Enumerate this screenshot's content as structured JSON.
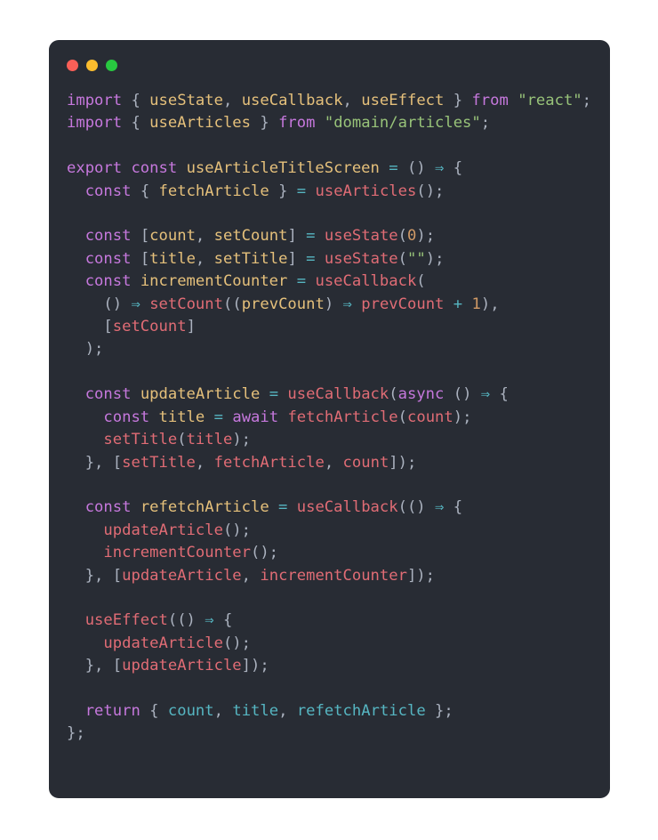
{
  "window": {
    "chrome_dots": [
      {
        "name": "close-dot",
        "color": "#fa5f57"
      },
      {
        "name": "minimize-dot",
        "color": "#fbbd2e"
      },
      {
        "name": "maximize-dot",
        "color": "#28c840"
      }
    ]
  },
  "theme": {
    "page_background": "#ffffff",
    "card_background": "#282c34",
    "default_text": "#abb2bf",
    "keyword": "#c678dd",
    "entity": "#e5c07b",
    "string": "#98c379",
    "function": "#e06c75",
    "variable": "#e06c75",
    "property": "#56b6c2",
    "operator": "#56b6c2",
    "number": "#d19a66",
    "punctuation": "#abb2bf"
  },
  "code": {
    "language": "javascript",
    "plain_text": "import { useState, useCallback, useEffect } from \"react\";\nimport { useArticles } from \"domain/articles\";\n\nexport const useArticleTitleScreen = () ⇒ {\n  const { fetchArticle } = useArticles();\n\n  const [count, setCount] = useState(0);\n  const [title, setTitle] = useState(\"\");\n  const incrementCounter = useCallback(\n    () ⇒ setCount((prevCount) ⇒ prevCount + 1),\n    [setCount]\n  );\n\n  const updateArticle = useCallback(async () ⇒ {\n    const title = await fetchArticle(count);\n    setTitle(title);\n  }, [setTitle, fetchArticle, count]);\n\n  const refetchArticle = useCallback(() ⇒ {\n    updateArticle();\n    incrementCounter();\n  }, [updateArticle, incrementCounter]);\n\n  useEffect(() ⇒ {\n    updateArticle();\n  }, [updateArticle]);\n\n  return { count, title, refetchArticle };\n};",
    "lines": [
      [
        {
          "k": "keyword",
          "t": "import"
        },
        {
          "k": "plain",
          "t": " "
        },
        {
          "k": "punct",
          "t": "{"
        },
        {
          "k": "plain",
          "t": " "
        },
        {
          "k": "entity",
          "t": "useState"
        },
        {
          "k": "punct",
          "t": ","
        },
        {
          "k": "plain",
          "t": " "
        },
        {
          "k": "entity",
          "t": "useCallback"
        },
        {
          "k": "punct",
          "t": ","
        },
        {
          "k": "plain",
          "t": " "
        },
        {
          "k": "entity",
          "t": "useEffect"
        },
        {
          "k": "plain",
          "t": " "
        },
        {
          "k": "punct",
          "t": "}"
        },
        {
          "k": "plain",
          "t": " "
        },
        {
          "k": "keyword",
          "t": "from"
        },
        {
          "k": "plain",
          "t": " "
        },
        {
          "k": "string",
          "t": "\"react\""
        },
        {
          "k": "punct",
          "t": ";"
        }
      ],
      [
        {
          "k": "keyword",
          "t": "import"
        },
        {
          "k": "plain",
          "t": " "
        },
        {
          "k": "punct",
          "t": "{"
        },
        {
          "k": "plain",
          "t": " "
        },
        {
          "k": "entity",
          "t": "useArticles"
        },
        {
          "k": "plain",
          "t": " "
        },
        {
          "k": "punct",
          "t": "}"
        },
        {
          "k": "plain",
          "t": " "
        },
        {
          "k": "keyword",
          "t": "from"
        },
        {
          "k": "plain",
          "t": " "
        },
        {
          "k": "string",
          "t": "\"domain/articles\""
        },
        {
          "k": "punct",
          "t": ";"
        }
      ],
      [],
      [
        {
          "k": "keyword",
          "t": "export"
        },
        {
          "k": "plain",
          "t": " "
        },
        {
          "k": "keyword",
          "t": "const"
        },
        {
          "k": "plain",
          "t": " "
        },
        {
          "k": "entity",
          "t": "useArticleTitleScreen"
        },
        {
          "k": "plain",
          "t": " "
        },
        {
          "k": "operator",
          "t": "="
        },
        {
          "k": "plain",
          "t": " "
        },
        {
          "k": "punct",
          "t": "()"
        },
        {
          "k": "plain",
          "t": " "
        },
        {
          "k": "operator",
          "t": "⇒"
        },
        {
          "k": "plain",
          "t": " "
        },
        {
          "k": "punct",
          "t": "{"
        }
      ],
      [
        {
          "k": "plain",
          "t": "  "
        },
        {
          "k": "keyword",
          "t": "const"
        },
        {
          "k": "plain",
          "t": " "
        },
        {
          "k": "punct",
          "t": "{"
        },
        {
          "k": "plain",
          "t": " "
        },
        {
          "k": "entity",
          "t": "fetchArticle"
        },
        {
          "k": "plain",
          "t": " "
        },
        {
          "k": "punct",
          "t": "}"
        },
        {
          "k": "plain",
          "t": " "
        },
        {
          "k": "operator",
          "t": "="
        },
        {
          "k": "plain",
          "t": " "
        },
        {
          "k": "func",
          "t": "useArticles"
        },
        {
          "k": "punct",
          "t": "();"
        }
      ],
      [],
      [
        {
          "k": "plain",
          "t": "  "
        },
        {
          "k": "keyword",
          "t": "const"
        },
        {
          "k": "plain",
          "t": " "
        },
        {
          "k": "punct",
          "t": "["
        },
        {
          "k": "entity",
          "t": "count"
        },
        {
          "k": "punct",
          "t": ","
        },
        {
          "k": "plain",
          "t": " "
        },
        {
          "k": "entity",
          "t": "setCount"
        },
        {
          "k": "punct",
          "t": "]"
        },
        {
          "k": "plain",
          "t": " "
        },
        {
          "k": "operator",
          "t": "="
        },
        {
          "k": "plain",
          "t": " "
        },
        {
          "k": "func",
          "t": "useState"
        },
        {
          "k": "punct",
          "t": "("
        },
        {
          "k": "number",
          "t": "0"
        },
        {
          "k": "punct",
          "t": ");"
        }
      ],
      [
        {
          "k": "plain",
          "t": "  "
        },
        {
          "k": "keyword",
          "t": "const"
        },
        {
          "k": "plain",
          "t": " "
        },
        {
          "k": "punct",
          "t": "["
        },
        {
          "k": "entity",
          "t": "title"
        },
        {
          "k": "punct",
          "t": ","
        },
        {
          "k": "plain",
          "t": " "
        },
        {
          "k": "entity",
          "t": "setTitle"
        },
        {
          "k": "punct",
          "t": "]"
        },
        {
          "k": "plain",
          "t": " "
        },
        {
          "k": "operator",
          "t": "="
        },
        {
          "k": "plain",
          "t": " "
        },
        {
          "k": "func",
          "t": "useState"
        },
        {
          "k": "punct",
          "t": "("
        },
        {
          "k": "string",
          "t": "\"\""
        },
        {
          "k": "punct",
          "t": ");"
        }
      ],
      [
        {
          "k": "plain",
          "t": "  "
        },
        {
          "k": "keyword",
          "t": "const"
        },
        {
          "k": "plain",
          "t": " "
        },
        {
          "k": "entity",
          "t": "incrementCounter"
        },
        {
          "k": "plain",
          "t": " "
        },
        {
          "k": "operator",
          "t": "="
        },
        {
          "k": "plain",
          "t": " "
        },
        {
          "k": "func",
          "t": "useCallback"
        },
        {
          "k": "punct",
          "t": "("
        }
      ],
      [
        {
          "k": "plain",
          "t": "    "
        },
        {
          "k": "punct",
          "t": "()"
        },
        {
          "k": "plain",
          "t": " "
        },
        {
          "k": "operator",
          "t": "⇒"
        },
        {
          "k": "plain",
          "t": " "
        },
        {
          "k": "func",
          "t": "setCount"
        },
        {
          "k": "punct",
          "t": "(("
        },
        {
          "k": "entity",
          "t": "prevCount"
        },
        {
          "k": "punct",
          "t": ")"
        },
        {
          "k": "plain",
          "t": " "
        },
        {
          "k": "operator",
          "t": "⇒"
        },
        {
          "k": "plain",
          "t": " "
        },
        {
          "k": "var",
          "t": "prevCount"
        },
        {
          "k": "plain",
          "t": " "
        },
        {
          "k": "operator",
          "t": "+"
        },
        {
          "k": "plain",
          "t": " "
        },
        {
          "k": "number",
          "t": "1"
        },
        {
          "k": "punct",
          "t": "),"
        }
      ],
      [
        {
          "k": "plain",
          "t": "    "
        },
        {
          "k": "punct",
          "t": "["
        },
        {
          "k": "var",
          "t": "setCount"
        },
        {
          "k": "punct",
          "t": "]"
        }
      ],
      [
        {
          "k": "plain",
          "t": "  "
        },
        {
          "k": "punct",
          "t": ");"
        }
      ],
      [],
      [
        {
          "k": "plain",
          "t": "  "
        },
        {
          "k": "keyword",
          "t": "const"
        },
        {
          "k": "plain",
          "t": " "
        },
        {
          "k": "entity",
          "t": "updateArticle"
        },
        {
          "k": "plain",
          "t": " "
        },
        {
          "k": "operator",
          "t": "="
        },
        {
          "k": "plain",
          "t": " "
        },
        {
          "k": "func",
          "t": "useCallback"
        },
        {
          "k": "punct",
          "t": "("
        },
        {
          "k": "keyword",
          "t": "async"
        },
        {
          "k": "plain",
          "t": " "
        },
        {
          "k": "punct",
          "t": "()"
        },
        {
          "k": "plain",
          "t": " "
        },
        {
          "k": "operator",
          "t": "⇒"
        },
        {
          "k": "plain",
          "t": " "
        },
        {
          "k": "punct",
          "t": "{"
        }
      ],
      [
        {
          "k": "plain",
          "t": "    "
        },
        {
          "k": "keyword",
          "t": "const"
        },
        {
          "k": "plain",
          "t": " "
        },
        {
          "k": "entity",
          "t": "title"
        },
        {
          "k": "plain",
          "t": " "
        },
        {
          "k": "operator",
          "t": "="
        },
        {
          "k": "plain",
          "t": " "
        },
        {
          "k": "keyword",
          "t": "await"
        },
        {
          "k": "plain",
          "t": " "
        },
        {
          "k": "func",
          "t": "fetchArticle"
        },
        {
          "k": "punct",
          "t": "("
        },
        {
          "k": "var",
          "t": "count"
        },
        {
          "k": "punct",
          "t": ");"
        }
      ],
      [
        {
          "k": "plain",
          "t": "    "
        },
        {
          "k": "func",
          "t": "setTitle"
        },
        {
          "k": "punct",
          "t": "("
        },
        {
          "k": "var",
          "t": "title"
        },
        {
          "k": "punct",
          "t": ");"
        }
      ],
      [
        {
          "k": "plain",
          "t": "  "
        },
        {
          "k": "punct",
          "t": "},"
        },
        {
          "k": "plain",
          "t": " "
        },
        {
          "k": "punct",
          "t": "["
        },
        {
          "k": "var",
          "t": "setTitle"
        },
        {
          "k": "punct",
          "t": ","
        },
        {
          "k": "plain",
          "t": " "
        },
        {
          "k": "var",
          "t": "fetchArticle"
        },
        {
          "k": "punct",
          "t": ","
        },
        {
          "k": "plain",
          "t": " "
        },
        {
          "k": "var",
          "t": "count"
        },
        {
          "k": "punct",
          "t": "]);"
        }
      ],
      [],
      [
        {
          "k": "plain",
          "t": "  "
        },
        {
          "k": "keyword",
          "t": "const"
        },
        {
          "k": "plain",
          "t": " "
        },
        {
          "k": "entity",
          "t": "refetchArticle"
        },
        {
          "k": "plain",
          "t": " "
        },
        {
          "k": "operator",
          "t": "="
        },
        {
          "k": "plain",
          "t": " "
        },
        {
          "k": "func",
          "t": "useCallback"
        },
        {
          "k": "punct",
          "t": "(()"
        },
        {
          "k": "plain",
          "t": " "
        },
        {
          "k": "operator",
          "t": "⇒"
        },
        {
          "k": "plain",
          "t": " "
        },
        {
          "k": "punct",
          "t": "{"
        }
      ],
      [
        {
          "k": "plain",
          "t": "    "
        },
        {
          "k": "func",
          "t": "updateArticle"
        },
        {
          "k": "punct",
          "t": "();"
        }
      ],
      [
        {
          "k": "plain",
          "t": "    "
        },
        {
          "k": "func",
          "t": "incrementCounter"
        },
        {
          "k": "punct",
          "t": "();"
        }
      ],
      [
        {
          "k": "plain",
          "t": "  "
        },
        {
          "k": "punct",
          "t": "},"
        },
        {
          "k": "plain",
          "t": " "
        },
        {
          "k": "punct",
          "t": "["
        },
        {
          "k": "var",
          "t": "updateArticle"
        },
        {
          "k": "punct",
          "t": ","
        },
        {
          "k": "plain",
          "t": " "
        },
        {
          "k": "var",
          "t": "incrementCounter"
        },
        {
          "k": "punct",
          "t": "]);"
        }
      ],
      [],
      [
        {
          "k": "plain",
          "t": "  "
        },
        {
          "k": "func",
          "t": "useEffect"
        },
        {
          "k": "punct",
          "t": "(()"
        },
        {
          "k": "plain",
          "t": " "
        },
        {
          "k": "operator",
          "t": "⇒"
        },
        {
          "k": "plain",
          "t": " "
        },
        {
          "k": "punct",
          "t": "{"
        }
      ],
      [
        {
          "k": "plain",
          "t": "    "
        },
        {
          "k": "func",
          "t": "updateArticle"
        },
        {
          "k": "punct",
          "t": "();"
        }
      ],
      [
        {
          "k": "plain",
          "t": "  "
        },
        {
          "k": "punct",
          "t": "},"
        },
        {
          "k": "plain",
          "t": " "
        },
        {
          "k": "punct",
          "t": "["
        },
        {
          "k": "var",
          "t": "updateArticle"
        },
        {
          "k": "punct",
          "t": "]);"
        }
      ],
      [],
      [
        {
          "k": "plain",
          "t": "  "
        },
        {
          "k": "keyword",
          "t": "return"
        },
        {
          "k": "plain",
          "t": " "
        },
        {
          "k": "punct",
          "t": "{"
        },
        {
          "k": "plain",
          "t": " "
        },
        {
          "k": "property",
          "t": "count"
        },
        {
          "k": "punct",
          "t": ","
        },
        {
          "k": "plain",
          "t": " "
        },
        {
          "k": "property",
          "t": "title"
        },
        {
          "k": "punct",
          "t": ","
        },
        {
          "k": "plain",
          "t": " "
        },
        {
          "k": "property",
          "t": "refetchArticle"
        },
        {
          "k": "plain",
          "t": " "
        },
        {
          "k": "punct",
          "t": "};"
        }
      ],
      [
        {
          "k": "punct",
          "t": "};"
        }
      ]
    ]
  }
}
